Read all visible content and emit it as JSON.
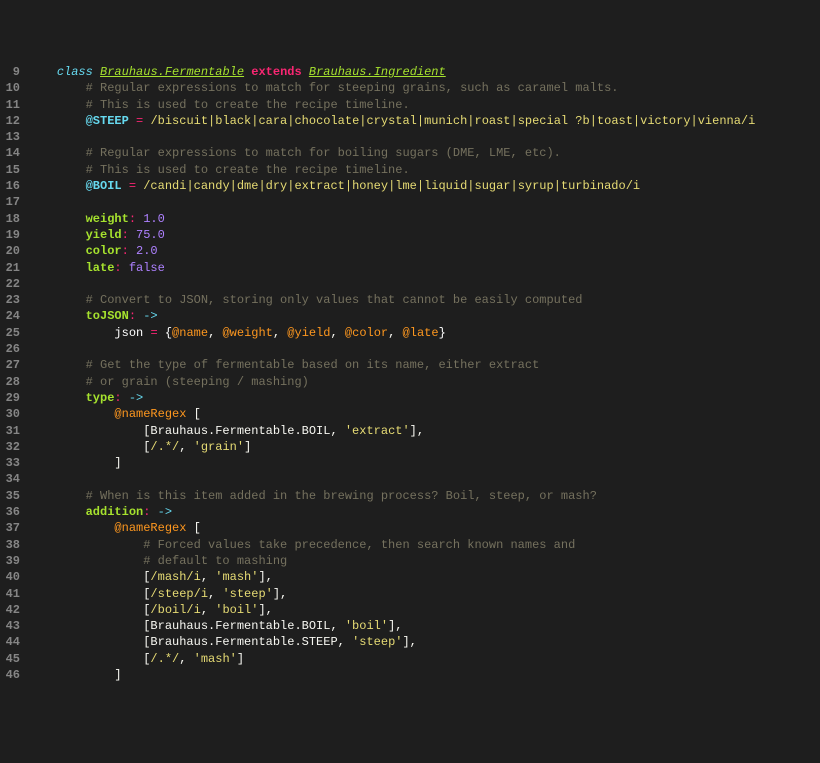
{
  "lines": [
    {
      "n": 9,
      "tokens": [
        {
          "t": "    ",
          "c": "plain"
        },
        {
          "t": "class",
          "c": "kw-class"
        },
        {
          "t": " ",
          "c": "plain"
        },
        {
          "t": "Brauhaus.Fermentable",
          "c": "classname"
        },
        {
          "t": " ",
          "c": "plain"
        },
        {
          "t": "extends",
          "c": "kw-extends"
        },
        {
          "t": " ",
          "c": "plain"
        },
        {
          "t": "Brauhaus.Ingredient",
          "c": "supername"
        }
      ]
    },
    {
      "n": 10,
      "tokens": [
        {
          "t": "        ",
          "c": "plain"
        },
        {
          "t": "# Regular expressions to match for steeping grains, such as caramel malts.",
          "c": "comment"
        }
      ]
    },
    {
      "n": 11,
      "tokens": [
        {
          "t": "        ",
          "c": "plain"
        },
        {
          "t": "# This is used to create the recipe timeline.",
          "c": "comment"
        }
      ]
    },
    {
      "n": 12,
      "tokens": [
        {
          "t": "        ",
          "c": "plain"
        },
        {
          "t": "@STEEP",
          "c": "decorator"
        },
        {
          "t": " ",
          "c": "plain"
        },
        {
          "t": "=",
          "c": "op-eq"
        },
        {
          "t": " ",
          "c": "plain"
        },
        {
          "t": "/biscuit|black|cara|chocolate|crystal|munich|roast|special ?b|toast|victory|vienna/i",
          "c": "regex"
        }
      ]
    },
    {
      "n": 13,
      "tokens": []
    },
    {
      "n": 14,
      "tokens": [
        {
          "t": "        ",
          "c": "plain"
        },
        {
          "t": "# Regular expressions to match for boiling sugars (DME, LME, etc).",
          "c": "comment"
        }
      ]
    },
    {
      "n": 15,
      "tokens": [
        {
          "t": "        ",
          "c": "plain"
        },
        {
          "t": "# This is used to create the recipe timeline.",
          "c": "comment"
        }
      ]
    },
    {
      "n": 16,
      "tokens": [
        {
          "t": "        ",
          "c": "plain"
        },
        {
          "t": "@BOIL",
          "c": "decorator"
        },
        {
          "t": " ",
          "c": "plain"
        },
        {
          "t": "=",
          "c": "op-eq"
        },
        {
          "t": " ",
          "c": "plain"
        },
        {
          "t": "/candi|candy|dme|dry|extract|honey|lme|liquid|sugar|syrup|turbinado/i",
          "c": "regex"
        }
      ]
    },
    {
      "n": 17,
      "tokens": []
    },
    {
      "n": 18,
      "tokens": [
        {
          "t": "        ",
          "c": "plain"
        },
        {
          "t": "weight",
          "c": "propname"
        },
        {
          "t": ":",
          "c": "colon"
        },
        {
          "t": " ",
          "c": "plain"
        },
        {
          "t": "1.0",
          "c": "number"
        }
      ]
    },
    {
      "n": 19,
      "tokens": [
        {
          "t": "        ",
          "c": "plain"
        },
        {
          "t": "yield",
          "c": "propname"
        },
        {
          "t": ":",
          "c": "colon"
        },
        {
          "t": " ",
          "c": "plain"
        },
        {
          "t": "75.0",
          "c": "number"
        }
      ]
    },
    {
      "n": 20,
      "tokens": [
        {
          "t": "        ",
          "c": "plain"
        },
        {
          "t": "color",
          "c": "propname"
        },
        {
          "t": ":",
          "c": "colon"
        },
        {
          "t": " ",
          "c": "plain"
        },
        {
          "t": "2.0",
          "c": "number"
        }
      ]
    },
    {
      "n": 21,
      "tokens": [
        {
          "t": "        ",
          "c": "plain"
        },
        {
          "t": "late",
          "c": "propname"
        },
        {
          "t": ":",
          "c": "colon"
        },
        {
          "t": " ",
          "c": "plain"
        },
        {
          "t": "false",
          "c": "boolfalse"
        }
      ]
    },
    {
      "n": 22,
      "tokens": []
    },
    {
      "n": 23,
      "tokens": [
        {
          "t": "        ",
          "c": "plain"
        },
        {
          "t": "# Convert to JSON, storing only values that cannot be easily computed",
          "c": "comment"
        }
      ]
    },
    {
      "n": 24,
      "tokens": [
        {
          "t": "        ",
          "c": "plain"
        },
        {
          "t": "toJSON",
          "c": "propname"
        },
        {
          "t": ":",
          "c": "colon"
        },
        {
          "t": " ",
          "c": "plain"
        },
        {
          "t": "->",
          "c": "arrow"
        }
      ]
    },
    {
      "n": 25,
      "tokens": [
        {
          "t": "            ",
          "c": "plain"
        },
        {
          "t": "json",
          "c": "var"
        },
        {
          "t": " ",
          "c": "plain"
        },
        {
          "t": "=",
          "c": "op-eq"
        },
        {
          "t": " ",
          "c": "plain"
        },
        {
          "t": "{",
          "c": "brace"
        },
        {
          "t": "@name",
          "c": "atvar"
        },
        {
          "t": ", ",
          "c": "plain"
        },
        {
          "t": "@weight",
          "c": "atvar"
        },
        {
          "t": ", ",
          "c": "plain"
        },
        {
          "t": "@yield",
          "c": "atvar"
        },
        {
          "t": ", ",
          "c": "plain"
        },
        {
          "t": "@color",
          "c": "atvar"
        },
        {
          "t": ", ",
          "c": "plain"
        },
        {
          "t": "@late",
          "c": "atvar"
        },
        {
          "t": "}",
          "c": "brace"
        }
      ]
    },
    {
      "n": 26,
      "tokens": []
    },
    {
      "n": 27,
      "tokens": [
        {
          "t": "        ",
          "c": "plain"
        },
        {
          "t": "# Get the type of fermentable based on its name, either extract",
          "c": "comment"
        }
      ]
    },
    {
      "n": 28,
      "tokens": [
        {
          "t": "        ",
          "c": "plain"
        },
        {
          "t": "# or grain (steeping / mashing)",
          "c": "comment"
        }
      ]
    },
    {
      "n": 29,
      "tokens": [
        {
          "t": "        ",
          "c": "plain"
        },
        {
          "t": "type",
          "c": "propname"
        },
        {
          "t": ":",
          "c": "colon"
        },
        {
          "t": " ",
          "c": "plain"
        },
        {
          "t": "->",
          "c": "arrow"
        }
      ]
    },
    {
      "n": 30,
      "tokens": [
        {
          "t": "            ",
          "c": "plain"
        },
        {
          "t": "@nameRegex",
          "c": "atvar"
        },
        {
          "t": " ",
          "c": "plain"
        },
        {
          "t": "[",
          "c": "bracket"
        }
      ]
    },
    {
      "n": 31,
      "tokens": [
        {
          "t": "                ",
          "c": "plain"
        },
        {
          "t": "[",
          "c": "bracket"
        },
        {
          "t": "Brauhaus.Fermentable.BOIL",
          "c": "plain"
        },
        {
          "t": ", ",
          "c": "plain"
        },
        {
          "t": "'extract'",
          "c": "string"
        },
        {
          "t": "],",
          "c": "bracket"
        }
      ]
    },
    {
      "n": 32,
      "tokens": [
        {
          "t": "                ",
          "c": "plain"
        },
        {
          "t": "[",
          "c": "bracket"
        },
        {
          "t": "/.*/",
          "c": "regex"
        },
        {
          "t": ", ",
          "c": "plain"
        },
        {
          "t": "'grain'",
          "c": "string"
        },
        {
          "t": "]",
          "c": "bracket"
        }
      ]
    },
    {
      "n": 33,
      "tokens": [
        {
          "t": "            ",
          "c": "plain"
        },
        {
          "t": "]",
          "c": "bracket"
        }
      ]
    },
    {
      "n": 34,
      "tokens": []
    },
    {
      "n": 35,
      "tokens": [
        {
          "t": "        ",
          "c": "plain"
        },
        {
          "t": "# When is this item added in the brewing process? Boil, steep, or mash?",
          "c": "comment"
        }
      ]
    },
    {
      "n": 36,
      "tokens": [
        {
          "t": "        ",
          "c": "plain"
        },
        {
          "t": "addition",
          "c": "propname"
        },
        {
          "t": ":",
          "c": "colon"
        },
        {
          "t": " ",
          "c": "plain"
        },
        {
          "t": "->",
          "c": "arrow"
        }
      ]
    },
    {
      "n": 37,
      "tokens": [
        {
          "t": "            ",
          "c": "plain"
        },
        {
          "t": "@nameRegex",
          "c": "atvar"
        },
        {
          "t": " ",
          "c": "plain"
        },
        {
          "t": "[",
          "c": "bracket"
        }
      ]
    },
    {
      "n": 38,
      "tokens": [
        {
          "t": "                ",
          "c": "plain"
        },
        {
          "t": "# Forced values take precedence, then search known names and",
          "c": "comment"
        }
      ]
    },
    {
      "n": 39,
      "tokens": [
        {
          "t": "                ",
          "c": "plain"
        },
        {
          "t": "# default to mashing",
          "c": "comment"
        }
      ]
    },
    {
      "n": 40,
      "tokens": [
        {
          "t": "                ",
          "c": "plain"
        },
        {
          "t": "[",
          "c": "bracket"
        },
        {
          "t": "/mash/i",
          "c": "regex"
        },
        {
          "t": ", ",
          "c": "plain"
        },
        {
          "t": "'mash'",
          "c": "string"
        },
        {
          "t": "],",
          "c": "bracket"
        }
      ]
    },
    {
      "n": 41,
      "tokens": [
        {
          "t": "                ",
          "c": "plain"
        },
        {
          "t": "[",
          "c": "bracket"
        },
        {
          "t": "/steep/i",
          "c": "regex"
        },
        {
          "t": ", ",
          "c": "plain"
        },
        {
          "t": "'steep'",
          "c": "string"
        },
        {
          "t": "],",
          "c": "bracket"
        }
      ]
    },
    {
      "n": 42,
      "tokens": [
        {
          "t": "                ",
          "c": "plain"
        },
        {
          "t": "[",
          "c": "bracket"
        },
        {
          "t": "/boil/i",
          "c": "regex"
        },
        {
          "t": ", ",
          "c": "plain"
        },
        {
          "t": "'boil'",
          "c": "string"
        },
        {
          "t": "],",
          "c": "bracket"
        }
      ]
    },
    {
      "n": 43,
      "tokens": [
        {
          "t": "                ",
          "c": "plain"
        },
        {
          "t": "[",
          "c": "bracket"
        },
        {
          "t": "Brauhaus.Fermentable.BOIL",
          "c": "plain"
        },
        {
          "t": ", ",
          "c": "plain"
        },
        {
          "t": "'boil'",
          "c": "string"
        },
        {
          "t": "],",
          "c": "bracket"
        }
      ]
    },
    {
      "n": 44,
      "tokens": [
        {
          "t": "                ",
          "c": "plain"
        },
        {
          "t": "[",
          "c": "bracket"
        },
        {
          "t": "Brauhaus.Fermentable.STEEP",
          "c": "plain"
        },
        {
          "t": ", ",
          "c": "plain"
        },
        {
          "t": "'steep'",
          "c": "string"
        },
        {
          "t": "],",
          "c": "bracket"
        }
      ]
    },
    {
      "n": 45,
      "tokens": [
        {
          "t": "                ",
          "c": "plain"
        },
        {
          "t": "[",
          "c": "bracket"
        },
        {
          "t": "/.*/",
          "c": "regex"
        },
        {
          "t": ", ",
          "c": "plain"
        },
        {
          "t": "'mash'",
          "c": "string"
        },
        {
          "t": "]",
          "c": "bracket"
        }
      ]
    },
    {
      "n": 46,
      "tokens": [
        {
          "t": "            ",
          "c": "plain"
        },
        {
          "t": "]",
          "c": "bracket"
        }
      ]
    }
  ]
}
